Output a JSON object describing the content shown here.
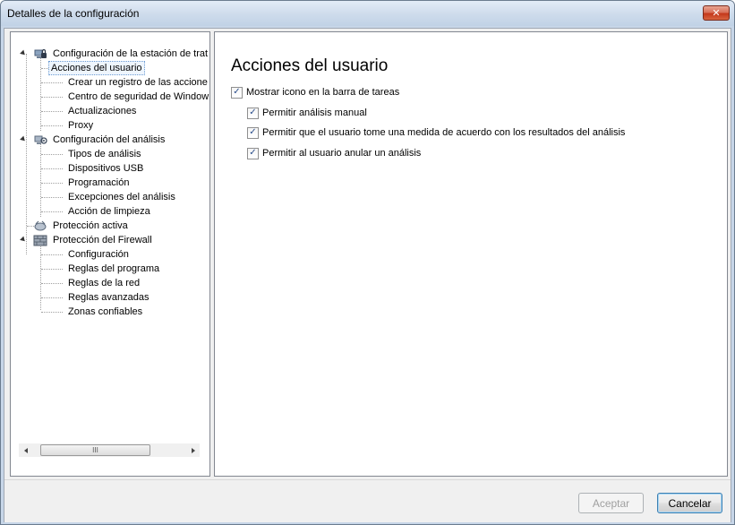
{
  "window": {
    "title": "Detalles de la configuración",
    "close_glyph": "✕"
  },
  "tree": {
    "groups": [
      {
        "label": "Configuración de la estación de trat",
        "icon": "workstation-lock-icon",
        "children": [
          "Acciones del usuario",
          "Crear un registro de las accione",
          "Centro de seguridad de Window",
          "Actualizaciones",
          "Proxy"
        ]
      },
      {
        "label": "Configuración del análisis",
        "icon": "scan-config-icon",
        "children": [
          "Tipos de análisis",
          "Dispositivos USB",
          "Programación",
          "Excepciones del análisis",
          "Acción de limpieza"
        ]
      },
      {
        "label": "Protección activa",
        "icon": "active-protection-icon",
        "children": []
      },
      {
        "label": "Protección del Firewall",
        "icon": "firewall-icon",
        "children": [
          "Configuración",
          "Reglas del  programa",
          "Reglas de la red",
          "Reglas avanzadas",
          "Zonas confiables"
        ]
      }
    ],
    "selected": "Acciones del usuario",
    "scrollbar_grip": "III"
  },
  "content": {
    "title": "Acciones del usuario",
    "options": [
      {
        "label": "Mostrar icono en la barra de tareas",
        "checked": true,
        "level": 0
      },
      {
        "label": "Permitir análisis manual",
        "checked": true,
        "level": 1
      },
      {
        "label": "Permitir que el usuario tome una medida de acuerdo con los resultados del análisis",
        "checked": true,
        "level": 1
      },
      {
        "label": "Permitir al usuario anular un análisis",
        "checked": true,
        "level": 1
      }
    ],
    "check_glyph": "✓"
  },
  "footer": {
    "accept_label": "Aceptar",
    "cancel_label": "Cancelar"
  }
}
